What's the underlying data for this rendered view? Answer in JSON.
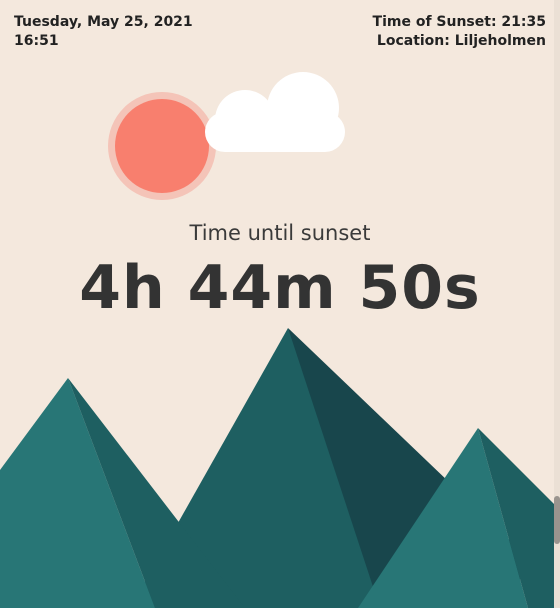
{
  "header": {
    "date": "Tuesday, May 25, 2021",
    "time": "16:51",
    "sunset_time": "Time of Sunset: 21:35",
    "location": "Location: Liljeholmen"
  },
  "main": {
    "subtitle": "Time until sunset",
    "countdown": "4h 44m 50s"
  },
  "colors": {
    "background": "#F4E8DD",
    "sun": "#F87F6E",
    "sun_halo": "#F4C4B8",
    "cloud": "#FFFFFF",
    "mountain_light": "#287676",
    "mountain_mid": "#1E5F61",
    "mountain_dark": "#18464C"
  },
  "icons": {
    "sun": "sun-icon",
    "cloud": "cloud-icon"
  }
}
